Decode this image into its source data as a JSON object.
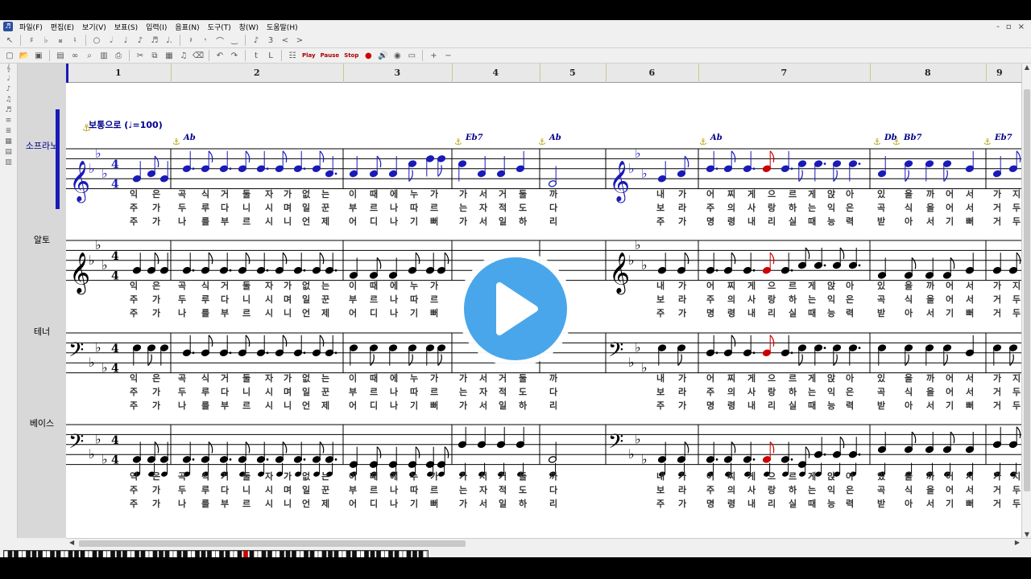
{
  "menu": [
    "파일(F)",
    "편집(E)",
    "보기(V)",
    "보표(S)",
    "입력(I)",
    "음표(N)",
    "도구(T)",
    "창(W)",
    "도움말(H)"
  ],
  "window_controls": [
    "-",
    "▫",
    "×"
  ],
  "toolbar": {
    "play": "Play",
    "pause": "Pause",
    "stop": "Stop"
  },
  "measures": [
    "1",
    "2",
    "3",
    "4",
    "5",
    "6",
    "7",
    "8",
    "9"
  ],
  "parts": [
    {
      "name": "소프라노",
      "active": true
    },
    {
      "name": "알토",
      "active": false
    },
    {
      "name": "테너",
      "active": false
    },
    {
      "name": "베이스",
      "active": false
    }
  ],
  "tempo": {
    "text": "보통으로",
    "bpm": "=100"
  },
  "chords": [
    {
      "symbol": "Ab",
      "measure": 2
    },
    {
      "symbol": "Eb7",
      "measure": 4
    },
    {
      "symbol": "Ab",
      "measure": 5
    },
    {
      "symbol": "Ab",
      "measure": 7
    },
    {
      "symbol": "Db",
      "measure": 8
    },
    {
      "symbol": "Bb7",
      "measure": 8
    },
    {
      "symbol": "Eb7",
      "measure": 9
    }
  ],
  "lyrics": {
    "full": [
      [
        "익",
        "은",
        "곡",
        "식",
        "거",
        "둘",
        "자",
        "가",
        "없",
        "는",
        "이",
        "때",
        "에",
        "누",
        "가",
        "가",
        "서",
        "거",
        "둘",
        "까",
        "내",
        "가",
        "어",
        "찌",
        "게",
        "으",
        "르",
        "게",
        "앉",
        "아",
        "있",
        "을",
        "까",
        "어",
        "서",
        "가",
        "지"
      ],
      [
        "주",
        "가",
        "두",
        "루",
        "다",
        "니",
        "시",
        "며",
        "일",
        "꾼",
        "부",
        "르",
        "나",
        "따",
        "르",
        "는",
        "자",
        "적",
        "도",
        "다",
        "보",
        "라",
        "주",
        "의",
        "사",
        "랑",
        "하",
        "는",
        "익",
        "은",
        "곡",
        "식",
        "을",
        "어",
        "서",
        "거",
        "두"
      ],
      [
        "주",
        "가",
        "나",
        "를",
        "부",
        "르",
        "시",
        "니",
        "언",
        "제",
        "어",
        "디",
        "나",
        "기",
        "뻐",
        "가",
        "서",
        "일",
        "하",
        "리",
        "주",
        "가",
        "명",
        "령",
        "내",
        "리",
        "실",
        "때",
        "능",
        "력",
        "받",
        "아",
        "서",
        "기",
        "뻐",
        "거",
        "두"
      ]
    ],
    "alto": [
      [
        "익",
        "은",
        "곡",
        "식",
        "거",
        "둘",
        "자",
        "가",
        "없",
        "는",
        "이",
        "때",
        "에",
        "누",
        "가",
        "내",
        "가",
        "어",
        "찌",
        "게",
        "으",
        "르",
        "게",
        "앉",
        "아",
        "있",
        "을",
        "까",
        "어",
        "서",
        "가",
        "지"
      ],
      [
        "주",
        "가",
        "두",
        "루",
        "다",
        "니",
        "시",
        "며",
        "일",
        "꾼",
        "부",
        "르",
        "나",
        "따",
        "르",
        "보",
        "라",
        "주",
        "의",
        "사",
        "랑",
        "하",
        "는",
        "익",
        "은",
        "곡",
        "식",
        "을",
        "어",
        "서",
        "거",
        "두"
      ],
      [
        "주",
        "가",
        "나",
        "를",
        "부",
        "르",
        "시",
        "니",
        "언",
        "제",
        "어",
        "디",
        "나",
        "기",
        "뻐",
        "주",
        "가",
        "명",
        "령",
        "내",
        "리",
        "실",
        "때",
        "능",
        "력",
        "받",
        "아",
        "서",
        "기",
        "뻐",
        "거",
        "두"
      ]
    ]
  },
  "colors": {
    "accent": "#1a1ab8",
    "highlight_note": "#cc0000",
    "play_button": "#4aa6ea"
  }
}
